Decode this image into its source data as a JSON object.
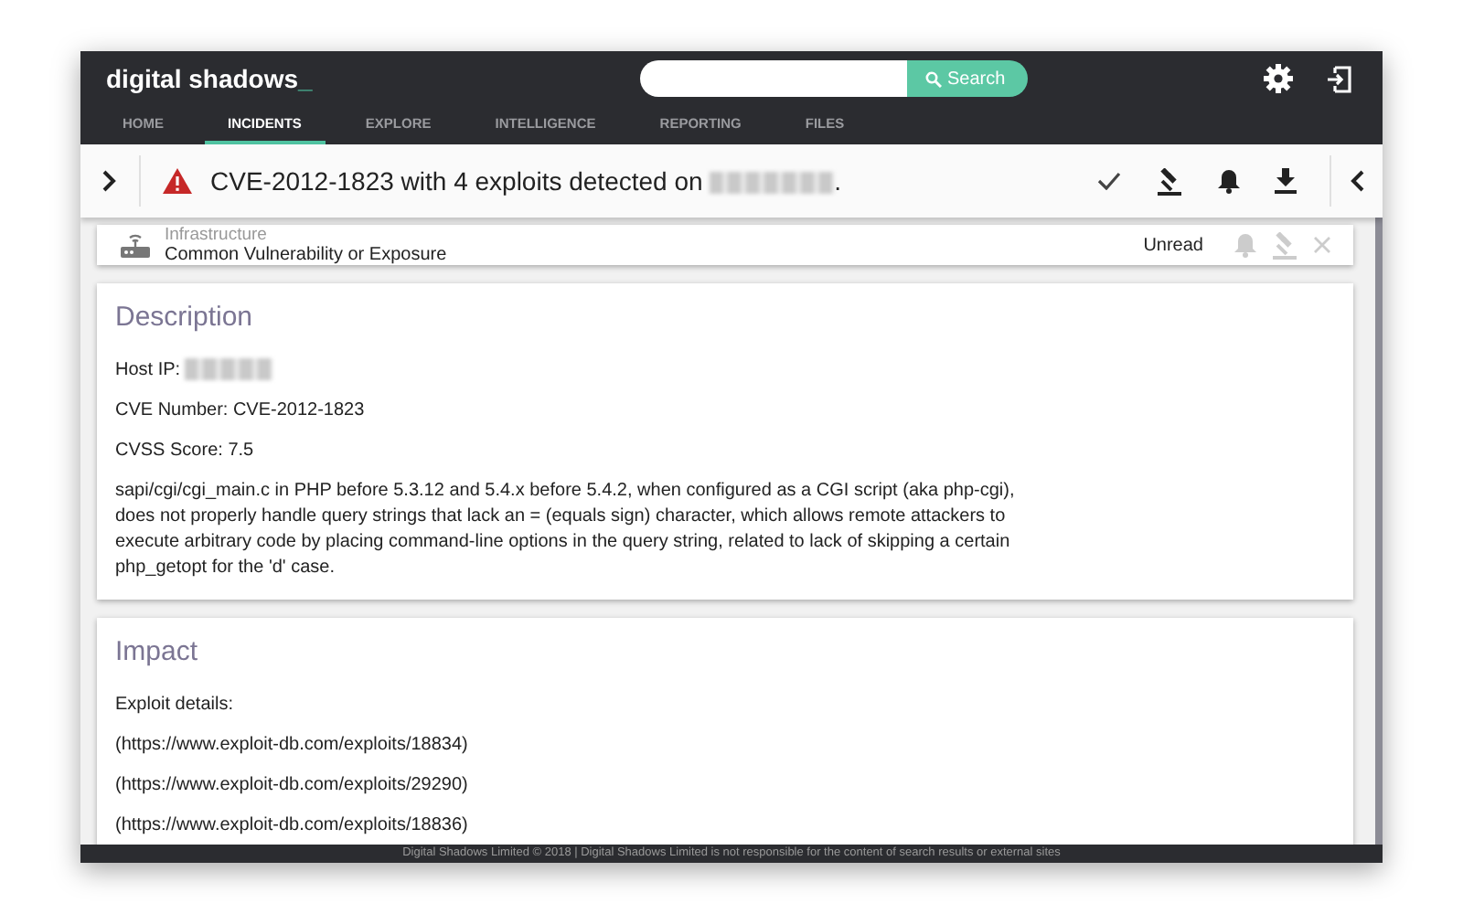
{
  "header": {
    "logo": "digital shadows",
    "logo_cursor": "_",
    "search_button": "Search",
    "tabs": [
      {
        "label": "HOME",
        "selected": false
      },
      {
        "label": "INCIDENTS",
        "selected": true
      },
      {
        "label": "EXPLORE",
        "selected": false
      },
      {
        "label": "INTELLIGENCE",
        "selected": false
      },
      {
        "label": "REPORTING",
        "selected": false
      },
      {
        "label": "FILES",
        "selected": false
      }
    ]
  },
  "toolbar": {
    "title": "CVE-2012-1823 with 4 exploits detected on",
    "title_end": "."
  },
  "summary": {
    "category": "Infrastructure",
    "type": "Common Vulnerability or Exposure",
    "status": "Unread"
  },
  "description": {
    "heading": "Description",
    "host_ip_label": "Host IP:",
    "lines": [
      "CVE Number: CVE-2012-1823",
      "CVSS Score: 7.5"
    ],
    "paragraph": "sapi/cgi/cgi_main.c in PHP before 5.3.12 and 5.4.x before 5.4.2, when configured as a CGI script (aka php-cgi), does not properly handle query strings that lack an = (equals sign) character, which allows remote attackers to execute arbitrary code by placing command-line options in the query string, related to lack of skipping a certain php_getopt for the 'd' case."
  },
  "impact": {
    "heading": "Impact",
    "lines": [
      "Exploit details:",
      "(https://www.exploit-db.com/exploits/18834)",
      "(https://www.exploit-db.com/exploits/29290)",
      "(https://www.exploit-db.com/exploits/18836)"
    ]
  },
  "footer": {
    "text": "Digital Shadows Limited © 2018 | Digital Shadows Limited is not responsible for the content of search results or external sites"
  }
}
